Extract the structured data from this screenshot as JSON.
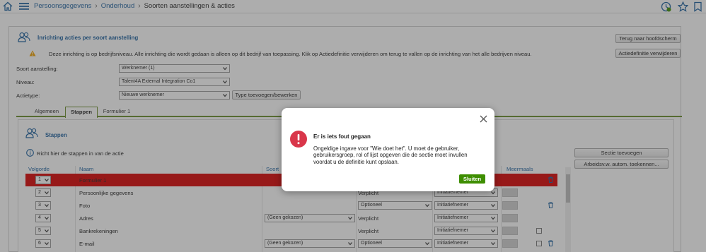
{
  "breadcrumb": [
    "Persoonsgegevens",
    "Onderhoud",
    "Soorten aanstellingen & acties"
  ],
  "icons": {
    "home": "home-icon",
    "menu": "menu-icon",
    "clock": "clock-icon",
    "star": "star-icon",
    "bookmark": "bookmark-icon"
  },
  "colors": {
    "accent": "#1a5f9e",
    "tab_border": "#6a8e2a",
    "error_row": "#d90000",
    "primary_button": "#3e8e00",
    "error_icon": "#d9364a"
  },
  "panel": {
    "title": "Inrichting acties per soort aanstelling",
    "back_button": "Terug naar hoofdscherm",
    "delete_button": "Actiedefinitie verwijderen",
    "warning": "Deze inrichting is op bedrijfsniveau. Alle inrichting die wordt gedaan is alleen op dit bedrijf van toepassing. Klik op Actiedefinitie verwijderen om terug te vallen op de inrichting van het alle bedrijven niveau.",
    "fields": [
      {
        "label": "Soort aanstelling:",
        "value": "Werknemer (1)"
      },
      {
        "label": "Niveau:",
        "value": "Talent4A External Integration Co1"
      },
      {
        "label": "Actietype:",
        "value": "Nieuwe werknemer"
      }
    ],
    "type_button": "Type toevoegen/bewerken"
  },
  "tabs": [
    "Algemeen",
    "Stappen",
    "Formulier 1"
  ],
  "active_tab": "Stappen",
  "steps": {
    "title": "Stappen",
    "info": "Richt hier de stappen in van de actie",
    "add_section_button": "Sectie toevoegen",
    "auto_assign_button": "Arbeidsv.w. autom. toekennen...",
    "columns": [
      "Volgorde",
      "Naam",
      "Soort",
      "Meermaals"
    ],
    "rows": [
      {
        "order": "1",
        "name": "Formulier 1",
        "type": "",
        "required": "",
        "who": ""
      },
      {
        "order": "2",
        "name": "Persoonlijke gegevens",
        "type": "",
        "required": "Verplicht",
        "who": "Initiatiefnemer"
      },
      {
        "order": "3",
        "name": "Foto",
        "type": "",
        "required": "Optioneel",
        "who": "Initiatiefnemer"
      },
      {
        "order": "4",
        "name": "Adres",
        "type": "(Geen gekozen)",
        "required": "Verplicht",
        "who": "Initiatiefnemer"
      },
      {
        "order": "5",
        "name": "Bankrekeningen",
        "type": "",
        "required": "Verplicht",
        "who": "Initiatiefnemer"
      },
      {
        "order": "6",
        "name": "E-mail",
        "type": "(Geen gekozen)",
        "required": "Optioneel",
        "who": "Initiatiefnemer"
      }
    ]
  },
  "modal": {
    "title": "Er is iets fout gegaan",
    "message": "Ongeldige ingave voor \"Wie doet het\". U moet de gebruiker, gebruikersgroep, rol of lijst opgeven die de sectie moet invullen voordat u de definitie kunt opslaan.",
    "close_button": "Sluiten"
  }
}
